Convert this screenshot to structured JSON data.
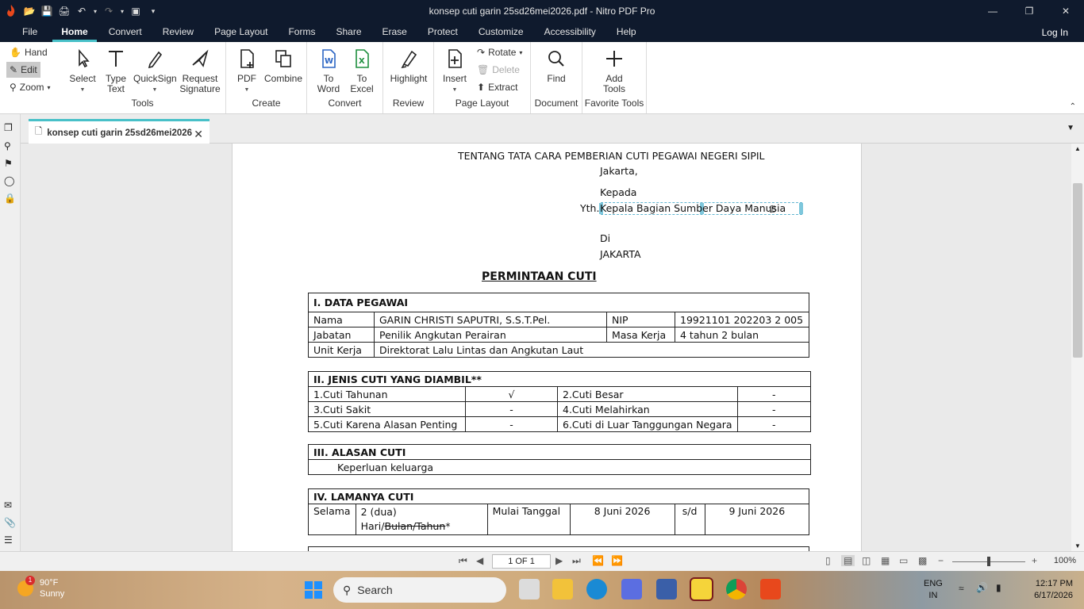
{
  "window": {
    "title": "konsep cuti garin 25sd26mei2026.pdf - Nitro PDF Pro"
  },
  "menu": {
    "tabs": [
      "File",
      "Home",
      "Convert",
      "Review",
      "Page Layout",
      "Forms",
      "Share",
      "Erase",
      "Protect",
      "Customize",
      "Accessibility",
      "Help"
    ],
    "active": "Home",
    "login": "Log In"
  },
  "ribbon": {
    "mode": {
      "hand": "Hand",
      "edit": "Edit",
      "zoom": "Zoom"
    },
    "tools": {
      "select": "Select",
      "type_text_1": "Type",
      "type_text_2": "Text",
      "quicksign": "QuickSign",
      "request_1": "Request",
      "request_2": "Signature",
      "label": "Tools"
    },
    "create": {
      "pdf": "PDF",
      "combine": "Combine",
      "label": "Create"
    },
    "convert": {
      "to_word_1": "To",
      "to_word_2": "Word",
      "to_excel_1": "To",
      "to_excel_2": "Excel",
      "label": "Convert"
    },
    "review": {
      "highlight": "Highlight",
      "label": "Review"
    },
    "page_layout": {
      "insert": "Insert",
      "rotate": "Rotate",
      "delete": "Delete",
      "extract": "Extract",
      "label": "Page Layout"
    },
    "document": {
      "find": "Find",
      "label": "Document"
    },
    "favorite": {
      "add_1": "Add",
      "add_2": "Tools",
      "label": "Favorite Tools"
    }
  },
  "doc_tab": {
    "label": "konsep cuti garin 25sd26mei2026"
  },
  "document": {
    "heading_line": "TENTANG TATA CARA PEMBERIAN CUTI PEGAWAI NEGERI SIPIL",
    "place_date": "Jakarta,",
    "kepada": "Kepada",
    "yth": "Yth.",
    "recipient": "Kepala Bagian Sumber Daya Manusia",
    "di": "Di",
    "city": "JAKARTA",
    "title": "PERMINTAAN CUTI",
    "section1": {
      "header": "I. DATA PEGAWAI",
      "nama_label": "Nama",
      "nama_value": "GARIN CHRISTI SAPUTRI, S.S.T.Pel.",
      "nip_label": "NIP",
      "nip_value": "19921101 202203 2 005",
      "jabatan_label": "Jabatan",
      "jabatan_value": "Penilik Angkutan Perairan",
      "masa_label": "Masa Kerja",
      "masa_value": "4 tahun 2 bulan",
      "unit_label": "Unit Kerja",
      "unit_value": "Direktorat Lalu Lintas dan Angkutan Laut"
    },
    "section2": {
      "header": "II.    JENIS CUTI YANG DIAMBIL**",
      "rows": [
        [
          "1.Cuti Tahunan",
          "√",
          "2.Cuti Besar",
          "-"
        ],
        [
          "3.Cuti Sakit",
          "-",
          "4.Cuti Melahirkan",
          "-"
        ],
        [
          "5.Cuti Karena Alasan Penting",
          "-",
          "6.Cuti di Luar Tanggungan Negara",
          "-"
        ]
      ]
    },
    "section3": {
      "header": "III.    ALASAN CUTI",
      "value": "Keperluan keluarga"
    },
    "section4": {
      "header": "IV.    LAMANYA CUTI",
      "selama_label": "Selama",
      "durasi_1": "2 (dua)",
      "durasi_hari": "Hari/",
      "durasi_strike": "Bulan/Tahun",
      "durasi_star": "*",
      "mulai_label": "Mulai Tanggal",
      "mulai_value": "8 Juni 2026",
      "sd": "s/d",
      "akhir_value": "9 Juni 2026"
    }
  },
  "navbar": {
    "page": "1 OF 1",
    "zoom": "100%"
  },
  "taskbar": {
    "temp": "90°F",
    "cond": "Sunny",
    "badge": "1",
    "search": "Search",
    "lang_1": "ENG",
    "lang_2": "IN",
    "time": "12:17 PM",
    "date": "6/17/2026"
  },
  "colors": {
    "titlebar": "#0f1a2d",
    "accent": "#48c0c8",
    "nitro_red": "#e8481c"
  }
}
